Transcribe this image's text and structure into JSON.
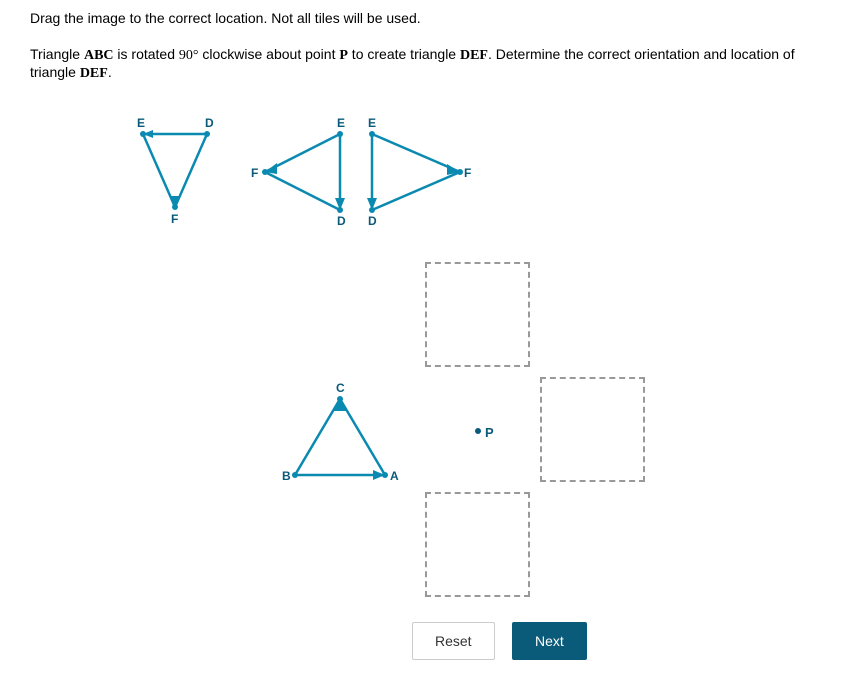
{
  "instruction": "Drag the image to the correct location. Not all tiles will be used.",
  "problem": {
    "prefix": "Triangle ",
    "abc": "ABC",
    "mid1": " is rotated ",
    "angle": "90°",
    "mid2": " clockwise about point ",
    "pointP": "P",
    "mid3": " to create triangle ",
    "def1": "DEF",
    "mid4": ". Determine the correct orientation and location of triangle ",
    "def2": "DEF",
    "suffix": "."
  },
  "labels": {
    "E": "E",
    "D": "D",
    "F": "F",
    "A": "A",
    "B": "B",
    "C": "C",
    "P": "P"
  },
  "buttons": {
    "reset": "Reset",
    "next": "Next"
  }
}
